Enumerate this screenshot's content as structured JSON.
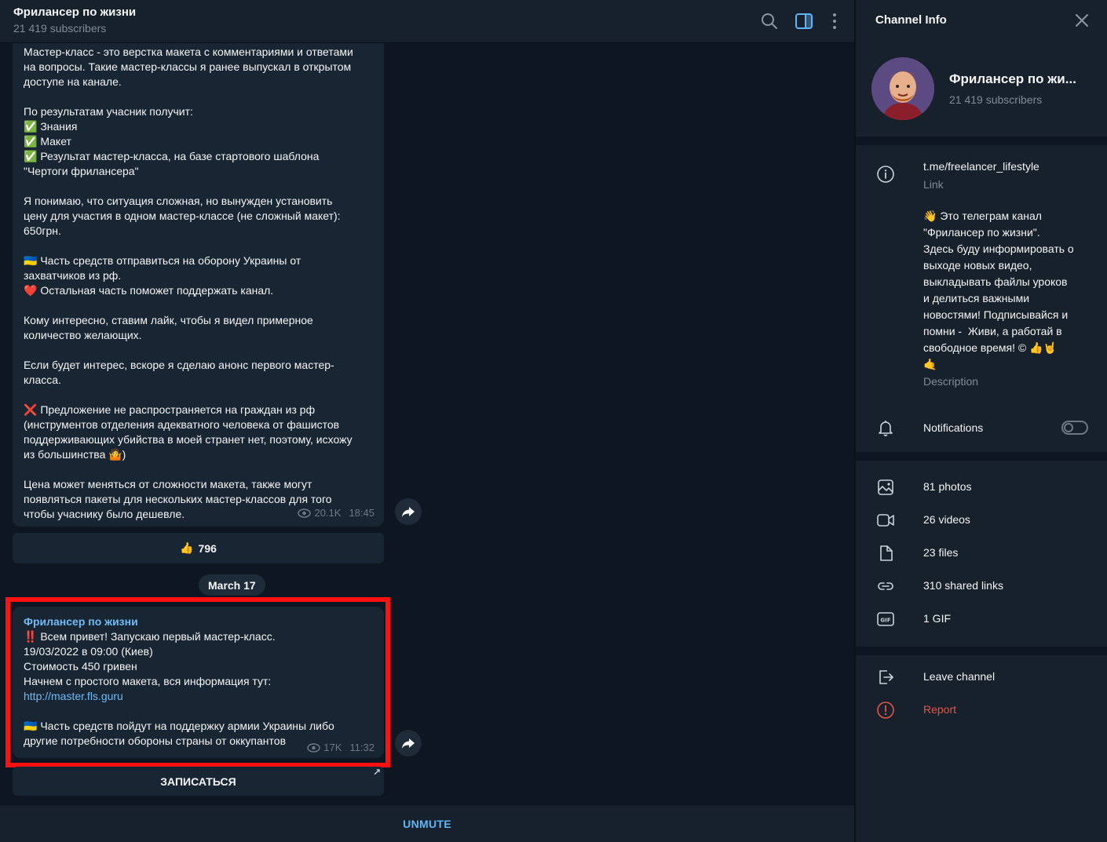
{
  "chat": {
    "title": "Фрилансер по жизни",
    "subscribers": "21 419 subscribers"
  },
  "message1": {
    "text": "Мастер-класс - это верстка макета с комментариями и ответами\nна вопросы. Такие мастер-классы я ранее выпускал в открытом\nдоступе на канале.\n\nПо результатам учасник получит:\n✅ Знания\n✅ Макет\n✅ Результат мастер-класса, на базе стартового шаблона\n\"Чертоги фрилансера\"\n\nЯ понимаю, что ситуация сложная, но вынужден установить\nцену для участия в одном мастер-классе (не сложный макет):\n650грн.\n\n🇺🇦 Часть средств отправиться на оборону Украины от\nзахватчиков из рф.\n❤️ Остальная часть поможет поддержать канал.\n\nКому интересно, ставим лайк, чтобы я видел примерное\nколичество желающих.\n\nЕсли будет интерес, вскоре я сделаю анонс первого мастер-\nкласса.\n\n❌ Предложение не распространяется на граждан из рф\n(инструментов отделения адекватного человека от фашистов\nподдерживающих убийства в моей странет нет, поэтому, исхожу\nиз большинства 🤷)\n\nЦена может меняться от сложности макета, также могут\nпоявляться пакеты для нескольких мастер-классов для того\nчтобы учаснику было дешевле.",
    "views": "20.1K",
    "time": "18:45",
    "reaction_emoji": "👍",
    "reaction_count": "796"
  },
  "date_separator": "March 17",
  "message2": {
    "author": "Фрилансер по жизни",
    "text_before_link": "‼️ Всем привет! Запускаю первый мастер-класс.\n19/03/2022 в 09:00 (Киев)\nСтоимость 450 гривен\nНачнем с простого макета, вся информация тут:\n",
    "link": "http://master.fls.guru",
    "text_after_link": "\n\n🇺🇦 Часть средств пойдут на поддержку армии Украины либо\nдругие потребности обороны страны от оккупантов",
    "views": "17K",
    "time": "11:32",
    "button_label": "ЗАПИСАТЬСЯ",
    "button_ext": "↗"
  },
  "bottom": {
    "unmute_label": "UNMUTE"
  },
  "info": {
    "header": "Channel Info",
    "name": "Фрилансер по жи...",
    "subscribers": "21 419 subscribers",
    "link": "t.me/freelancer_lifestyle",
    "link_label": "Link",
    "description": "👋 Это телеграм канал\n\"Фрилансер по жизни\".\nЗдесь буду информировать о\nвыходе новых видео,\nвыкладывать файлы уроков\nи делиться важными\nновостями! Подписывайся и\nпомни -  Живи, а работай в\nсвободное время! © 👍🤘\n🤙",
    "description_label": "Description",
    "notifications_label": "Notifications",
    "notifications_on": false,
    "media": {
      "photos": "81 photos",
      "videos": "26 videos",
      "files": "23 files",
      "links": "310 shared links",
      "gifs": "1 GIF"
    },
    "leave_label": "Leave channel",
    "report_label": "Report"
  },
  "colors": {
    "accent": "#71baf5",
    "highlight_border": "#ff1111",
    "report": "#e5534b"
  }
}
